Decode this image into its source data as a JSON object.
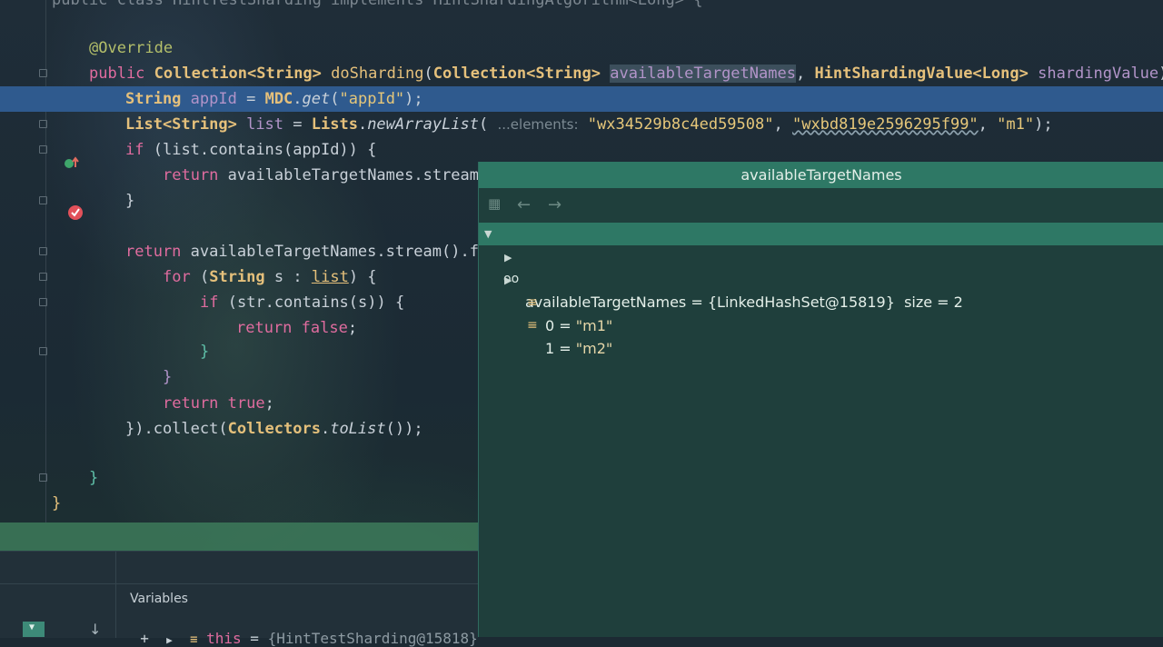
{
  "editor": {
    "lines": {
      "l0": "public class HintTestSharding implements HintShardingAlgorithm<Long> {",
      "annotation": "@Override",
      "kw_public": "public",
      "ty_collection": "Collection<String>",
      "method": "doSharding",
      "ty_collection2": "Collection<String>",
      "p_available": "availableTargetNames",
      "ty_hint": "HintShardingValue<Long>",
      "p_sharding": "shardingValue",
      "ty_string": "String",
      "v_appId": "appId",
      "mdc": "MDC",
      "get": "get",
      "str_appId": "\"appId\"",
      "ty_list": "List<String>",
      "v_list": "list",
      "lists": "Lists",
      "newArrayList": "newArrayList",
      "hint_elements": "...elements:",
      "str_wx1": "\"wx34529b8c4ed59508\"",
      "str_wx2": "\"wxbd819e2596295f99\"",
      "str_m1": "\"m1\"",
      "kw_if": "if",
      "contains_line": "(list.contains(appId)) {",
      "kw_return": "return",
      "ret1_rest": "availableTargetNames.stream",
      "brace_close": "}",
      "ret2_rest": "availableTargetNames.stream().f",
      "kw_for": "for",
      "ty_string2": "String",
      "for_var": "s",
      "for_list": "list",
      "if2": "(str.contains(s)) {",
      "kw_false": "false",
      "kw_true": "true",
      "collect_a": "}).collect(",
      "collectors": "Collectors",
      "toList": "toList",
      "collect_b": "());"
    }
  },
  "popup": {
    "title": "availableTargetNames",
    "root": {
      "name": "availableTargetNames",
      "value": "{LinkedHashSet@15819}",
      "size": "size = 2"
    },
    "items": [
      {
        "index": "0",
        "value": "\"m1\""
      },
      {
        "index": "1",
        "value": "\"m2\""
      }
    ]
  },
  "debugger": {
    "variables_title": "Variables",
    "this_name": "this",
    "this_value": "{HintTestSharding@15818}"
  },
  "colors": {
    "accent": "#2e7865",
    "highlight_line": "#2f5a8e",
    "keyword": "#e06c9f",
    "type": "#e5c07b"
  }
}
